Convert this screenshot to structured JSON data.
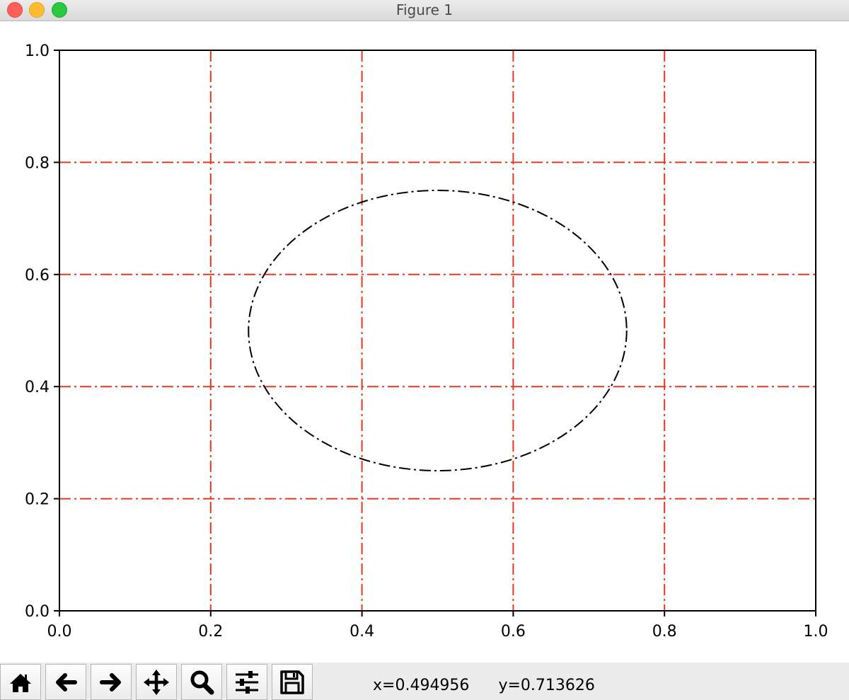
{
  "window": {
    "title": "Figure 1"
  },
  "chart_data": {
    "type": "line",
    "title": "",
    "xlabel": "",
    "ylabel": "",
    "xlim": [
      0.0,
      1.0
    ],
    "ylim": [
      0.0,
      1.0
    ],
    "xticks": [
      "0.0",
      "0.2",
      "0.4",
      "0.6",
      "0.8",
      "1.0"
    ],
    "yticks": [
      "0.0",
      "0.2",
      "0.4",
      "0.6",
      "0.8",
      "1.0"
    ],
    "grid": true,
    "grid_color": "#e8371e",
    "grid_style": "dashdot",
    "shapes": [
      {
        "kind": "ellipse",
        "center": [
          0.5,
          0.5
        ],
        "radius_x": 0.25,
        "radius_y": 0.25,
        "line_style": "dashdot",
        "color": "#000000"
      }
    ]
  },
  "toolbar": {
    "buttons": [
      {
        "name": "home",
        "icon": "home-icon",
        "tooltip": "Reset original view"
      },
      {
        "name": "back",
        "icon": "arrow-left-icon",
        "tooltip": "Back to previous view"
      },
      {
        "name": "forward",
        "icon": "arrow-right-icon",
        "tooltip": "Forward to next view"
      },
      {
        "name": "pan",
        "icon": "move-icon",
        "tooltip": "Pan axes"
      },
      {
        "name": "zoom",
        "icon": "magnifier-icon",
        "tooltip": "Zoom to rectangle"
      },
      {
        "name": "subplots",
        "icon": "sliders-icon",
        "tooltip": "Configure subplots"
      },
      {
        "name": "save",
        "icon": "floppy-disk-icon",
        "tooltip": "Save the figure"
      }
    ],
    "coords": {
      "x": "x=0.494956",
      "y": "y=0.713626"
    }
  }
}
